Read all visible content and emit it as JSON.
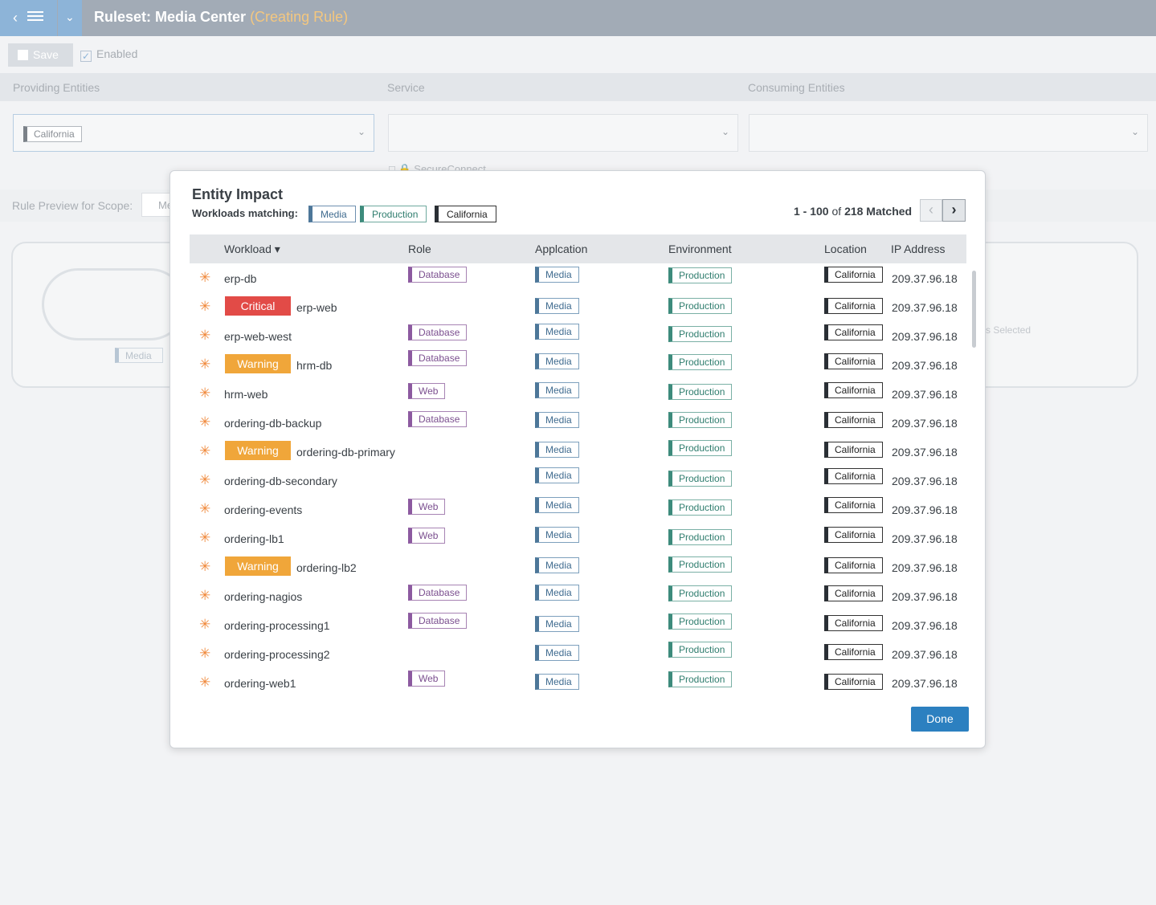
{
  "header": {
    "title": "Ruleset: Media Center",
    "subtitle": "(Creating Rule)"
  },
  "toolbar": {
    "save_label": "Save",
    "enabled_label": "Enabled"
  },
  "columns": {
    "providing": "Providing Entities",
    "service": "Service",
    "consuming": "Consuming Entities"
  },
  "providing_tag": "California",
  "secure_connect": "SecureConnect",
  "scope": {
    "label": "Rule Preview for Scope:",
    "value": "Me"
  },
  "background": {
    "media_tag": "Media",
    "selected_text": "s Selected"
  },
  "modal": {
    "title": "Entity Impact",
    "subtitle": "Workloads matching:",
    "chips": {
      "media": "Media",
      "production": "Production",
      "california": "California"
    },
    "matched_range": "1 - 100",
    "matched_of": "of",
    "matched_total": "218 Matched",
    "headers": {
      "workload": "Workload ▾",
      "role": "Role",
      "application": "Applcation",
      "environment": "Environment",
      "location": "Location",
      "ip": "IP Address"
    },
    "rows": [
      {
        "name": "erp-db",
        "badge": "",
        "role": "Database",
        "app": "Media",
        "env": "Production",
        "loc": "California",
        "ip": "209.37.96.18"
      },
      {
        "name": "erp-web",
        "badge": "Critical",
        "role": "",
        "app": "Media",
        "env": "Production",
        "loc": "California",
        "ip": "209.37.96.18"
      },
      {
        "name": "erp-web-west",
        "badge": "",
        "role": "Database",
        "app": "Media",
        "env": "Production",
        "loc": "California",
        "ip": "209.37.96.18"
      },
      {
        "name": "hrm-db",
        "badge": "Warning",
        "role": "Database",
        "app": "Media",
        "env": "Production",
        "loc": "California",
        "ip": "209.37.96.18"
      },
      {
        "name": "hrm-web",
        "badge": "",
        "role": "Web",
        "app": "Media",
        "env": "Production",
        "loc": "California",
        "ip": "209.37.96.18"
      },
      {
        "name": "ordering-db-backup",
        "badge": "",
        "role": "Database",
        "app": "Media",
        "env": "Production",
        "loc": "California",
        "ip": "209.37.96.18"
      },
      {
        "name": "ordering-db-primary",
        "badge": "Warning",
        "role": "",
        "app": "Media",
        "env": "Production",
        "loc": "California",
        "ip": "209.37.96.18"
      },
      {
        "name": "ordering-db-secondary",
        "badge": "",
        "role": "",
        "app": "Media",
        "env": "Production",
        "loc": "California",
        "ip": "209.37.96.18"
      },
      {
        "name": "ordering-events",
        "badge": "",
        "role": "Web",
        "app": "Media",
        "env": "Production",
        "loc": "California",
        "ip": "209.37.96.18"
      },
      {
        "name": "ordering-lb1",
        "badge": "",
        "role": "Web",
        "app": "Media",
        "env": "Production",
        "loc": "California",
        "ip": "209.37.96.18"
      },
      {
        "name": "ordering-lb2",
        "badge": "Warning",
        "role": "",
        "app": "Media",
        "env": "Production",
        "loc": "California",
        "ip": "209.37.96.18"
      },
      {
        "name": "ordering-nagios",
        "badge": "",
        "role": "Database",
        "app": "Media",
        "env": "Production",
        "loc": "California",
        "ip": "209.37.96.18"
      },
      {
        "name": "ordering-processing1",
        "badge": "",
        "role": "Database",
        "app": "Media",
        "env": "Production",
        "loc": "California",
        "ip": "209.37.96.18"
      },
      {
        "name": "ordering-processing2",
        "badge": "",
        "role": "",
        "app": "Media",
        "env": "Production",
        "loc": "California",
        "ip": "209.37.96.18"
      },
      {
        "name": "ordering-web1",
        "badge": "",
        "role": "Web",
        "app": "Media",
        "env": "Production",
        "loc": "California",
        "ip": "209.37.96.18"
      }
    ],
    "done_label": "Done"
  },
  "colors": {
    "critical": "#e24b47",
    "warning": "#f0a63a",
    "accent": "#2c80c0",
    "role": "#8c5aa0",
    "application": "#4d7799",
    "environment": "#3d8b7c"
  }
}
